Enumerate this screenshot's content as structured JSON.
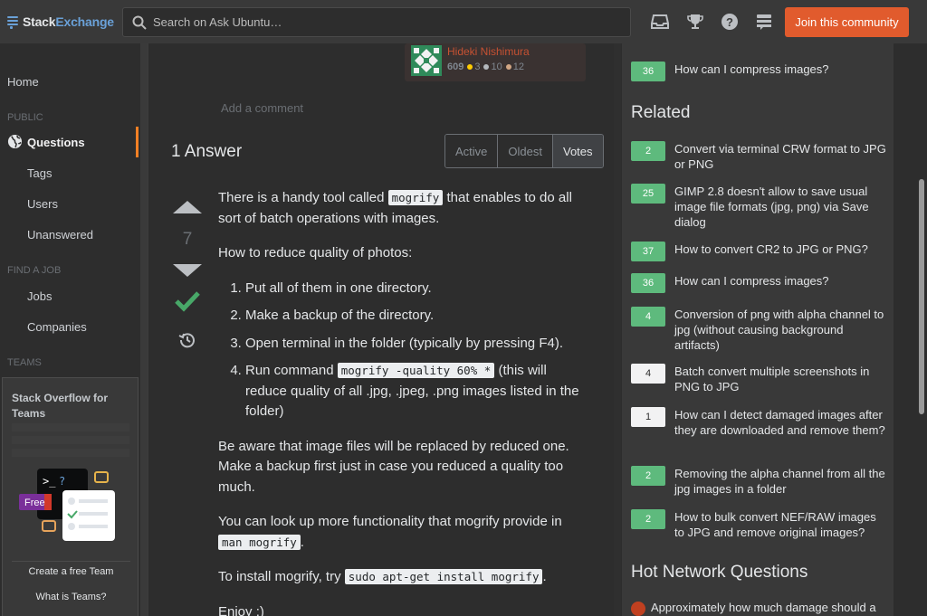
{
  "header": {
    "logo_stack": "Stack",
    "logo_exchange": "Exchange",
    "search_placeholder": "Search on Ask Ubuntu…",
    "join_label": "Join this community"
  },
  "sidebar": {
    "home": "Home",
    "public_label": "PUBLIC",
    "questions": "Questions",
    "tags": "Tags",
    "users": "Users",
    "unanswered": "Unanswered",
    "find_job_label": "FIND A JOB",
    "jobs": "Jobs",
    "companies": "Companies",
    "teams_label": "TEAMS",
    "teams_promo": {
      "title": "Stack Overflow for Teams",
      "badge": "Free",
      "create_team": "Create a free Team",
      "what_is_teams": "What is Teams?"
    }
  },
  "owner": {
    "name": "Hideki Nishimura",
    "reputation": "609",
    "gold": "3",
    "silver": "10",
    "bronze": "12"
  },
  "add_comment": "Add a comment",
  "answers": {
    "count_label": "1 Answer",
    "sort_tabs": [
      "Active",
      "Oldest",
      "Votes"
    ],
    "selected_tab": "Votes"
  },
  "answer": {
    "votes": "7",
    "intro_before": "There is a handy tool called ",
    "intro_code": "mogrify",
    "intro_after": " that enables to do all sort of batch operations with images.",
    "howto": "How to reduce quality of photos:",
    "step1": "Put all of them in one directory.",
    "step2": "Make a backup of the directory.",
    "step3": "Open terminal in the folder (typically by pressing F4).",
    "step4_before": "Run command ",
    "step4_code": "mogrify -quality 60% *",
    "step4_after": " (this will reduce quality of all .jpg, .jpeg, .png images listed in the folder)",
    "warning": "Be aware that image files will be replaced by reduced one. Make a backup first just in case you reduced a quality too much.",
    "more_before": "You can look up more functionality that mogrify provide in ",
    "more_code": "man mogrify",
    "more_after": ".",
    "install_before": "To install mogrify, try ",
    "install_code": "sudo apt-get install mogrify",
    "install_after": ".",
    "enjoy": "Enjoy :)"
  },
  "linked_top": {
    "score": "36",
    "title": "How can I compress images?"
  },
  "related": {
    "title": "Related",
    "items": [
      {
        "score": "2",
        "title": "Convert via terminal CRW format to JPG or PNG",
        "accepted": true
      },
      {
        "score": "25",
        "title": "GIMP 2.8 doesn't allow to save usual image file formats (jpg, png) via Save dialog",
        "accepted": true
      },
      {
        "score": "37",
        "title": "How to convert CR2 to JPG or PNG?",
        "accepted": true
      },
      {
        "score": "36",
        "title": "How can I compress images?",
        "accepted": true
      },
      {
        "score": "4",
        "title": "Conversion of png with alpha channel to jpg (without causing background artifacts)",
        "accepted": true
      },
      {
        "score": "4",
        "title": "Batch convert multiple screenshots in PNG to JPG",
        "accepted": false
      },
      {
        "score": "1",
        "title": "How can I detect damaged images after they are downloaded and remove them?",
        "accepted": false
      },
      {
        "score": "2",
        "title": "Removing the alpha channel from all the jpg images in a folder",
        "accepted": true
      },
      {
        "score": "2",
        "title": "How to bulk convert NEF/RAW images to JPG and remove original images?",
        "accepted": true
      }
    ]
  },
  "hot_network": {
    "title": "Hot Network Questions",
    "first": "Approximately how much damage should a"
  },
  "colors": {
    "accent": "#f48024",
    "join": "#e15b2d",
    "accepted_green": "#5eba7d",
    "link_blue": "#6aa1d8"
  }
}
